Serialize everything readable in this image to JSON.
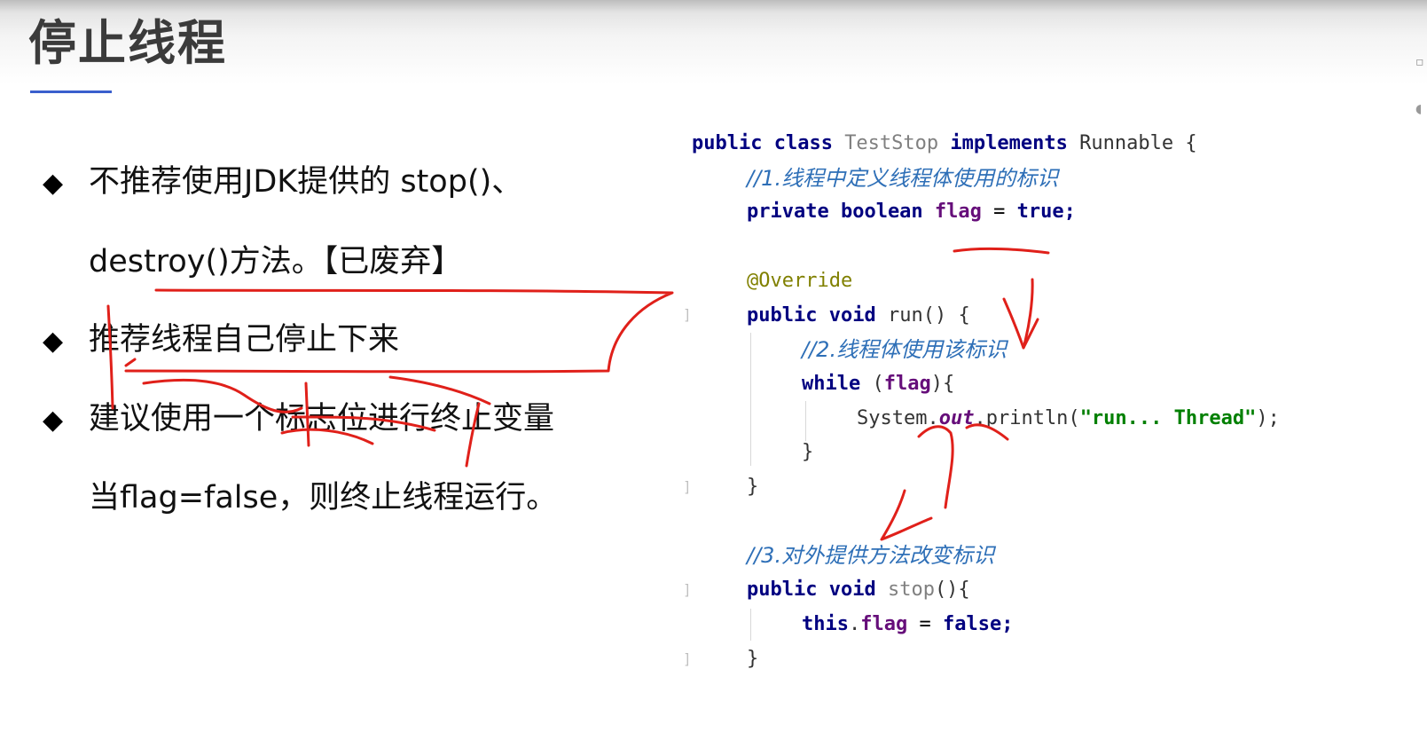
{
  "slide": {
    "title": "停止线程"
  },
  "bullets": [
    {
      "marker": "◆",
      "lines": [
        "不推荐使用JDK提供的 stop()、",
        "destroy()方法。【已废弃】"
      ]
    },
    {
      "marker": "◆",
      "lines": [
        "推荐线程自己停止下来"
      ]
    },
    {
      "marker": "◆",
      "lines": [
        "建议使用一个标志位进行终止变量",
        "当flag=false，则终止线程运行。"
      ]
    }
  ],
  "code": {
    "l1": {
      "kw1": "public class ",
      "cls": "TestStop",
      "kw2": " implements ",
      "id": "Runnable {"
    },
    "l2": "//1.线程中定义线程体使用的标识",
    "l3": {
      "kw": "private boolean ",
      "fld": "flag",
      "op": " = ",
      "val": "true",
      "end": ";"
    },
    "l4": "@Override",
    "l5": {
      "kw": "public void ",
      "name": "run",
      "end": "() {"
    },
    "l6": "//2.线程体使用该标识",
    "l7": {
      "kw": "while ",
      "p1": "(",
      "fld": "flag",
      "p2": "){"
    },
    "l8": {
      "a": "System.",
      "b": "out",
      "c": ".println(",
      "str": "\"run... Thread\"",
      "d": ");"
    },
    "l9": "}",
    "l10": "}",
    "l11": "//3.对外提供方法改变标识",
    "l12": {
      "kw": "public void ",
      "name": "stop",
      "end": "(){"
    },
    "l13": {
      "kw": "this",
      "dot": ".",
      "fld": "flag",
      "op": " = ",
      "val": "false",
      "end": ";"
    },
    "l14": "}"
  },
  "colors": {
    "title": "#3b3b3b",
    "title_underline": "#3a5fcd",
    "keyword": "#000080",
    "comment": "#2e6fb7",
    "annotation": "#808000",
    "string": "#008000",
    "field": "#660e7a",
    "pen_annotation": "#e0201a"
  }
}
